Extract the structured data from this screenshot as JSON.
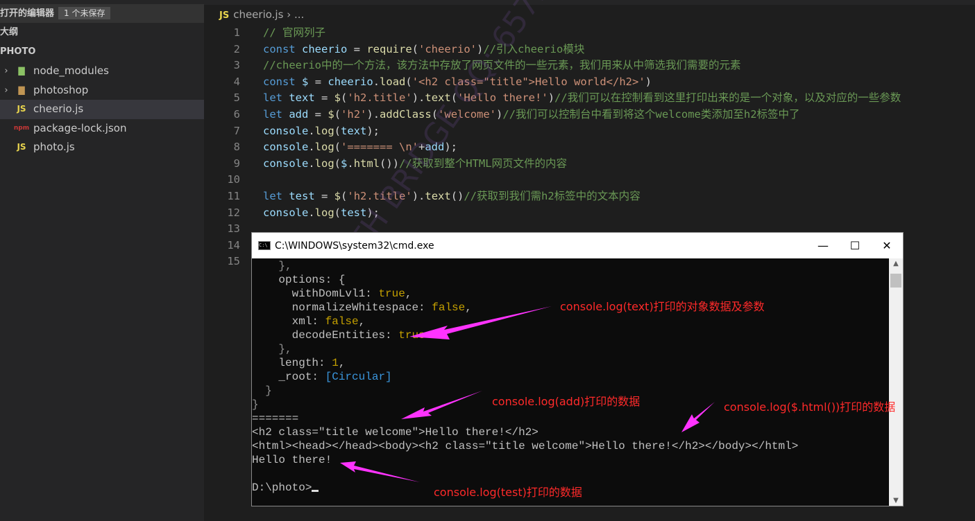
{
  "sidebar": {
    "open_editors": "打开的编辑器",
    "unsaved_badge": "1 个未保存",
    "outline": "大纲",
    "project": "PHOTO",
    "items": [
      {
        "label": "node_modules",
        "type": "folder-node",
        "expandable": true
      },
      {
        "label": "photoshop",
        "type": "folder",
        "expandable": true
      },
      {
        "label": "cheerio.js",
        "type": "js",
        "selected": true
      },
      {
        "label": "package-lock.json",
        "type": "json"
      },
      {
        "label": "photo.js",
        "type": "js"
      }
    ]
  },
  "editor": {
    "breadcrumb_file": "cheerio.js",
    "breadcrumb_more": "...",
    "js_badge": "JS",
    "lines": [
      "// 官网列子",
      "const cheerio = require('cheerio')//引入cheerio模块",
      "//cheerio中的一个方法，该方法中存放了网页文件的一些元素，我们用来从中筛选我们需要的元素",
      "const $ = cheerio.load('<h2 class=\"title\">Hello world</h2>')",
      "let text = $('h2.title').text('Hello there!')//我们可以在控制看到这里打印出来的是一个对象，以及对应的一些参数",
      "let add = $('h2').addClass('welcome')//我们可以控制台中看到将这个welcome类添加至h2标签中了",
      "console.log(text);",
      "console.log('======= \\n'+add);",
      "console.log($.html())//获取到整个HTML网页文件的内容",
      "",
      "let test = $('h2.title').text()//获取到我们需h2标签中的文本内容",
      "console.log(test);",
      "",
      "",
      ""
    ]
  },
  "cmd": {
    "title": "C:\\WINDOWS\\system32\\cmd.exe",
    "lines": [
      "    },",
      "    options: {",
      "      withDomLvl1: true,",
      "      normalizeWhitespace: false,",
      "      xml: false,",
      "      decodeEntities: true",
      "    },",
      "    length: 1,",
      "    _root: [Circular]",
      "  }",
      "}",
      "=======",
      "<h2 class=\"title welcome\">Hello there!</h2>",
      "<html><head></head><body><h2 class=\"title welcome\">Hello there!</h2></body></html>",
      "Hello there!",
      "",
      "D:\\photo>"
    ]
  },
  "annotations": [
    "console.log(text)打印的对象数据及参数",
    "console.log(add)打印的数据",
    "console.log($.html())打印的数据",
    "console.log(test)打印的数据"
  ],
  "watermark": "SOUTH BRIDGE QQ: 657997631",
  "colors": {
    "annotation": "#ff2a2a",
    "arrow": "#ff33ff"
  }
}
